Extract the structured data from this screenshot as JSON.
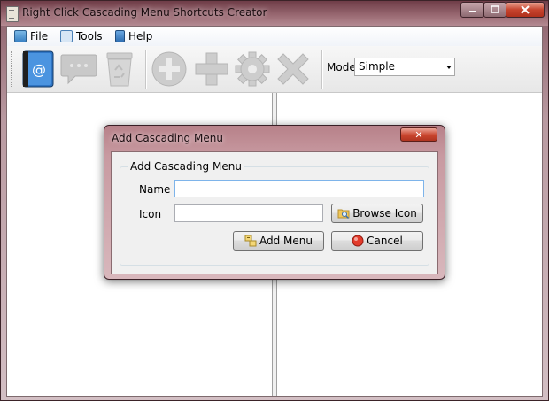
{
  "window": {
    "title": "Right Click Cascading Menu Shortcuts Creator"
  },
  "menubar": {
    "file": "File",
    "tools": "Tools",
    "help": "Help"
  },
  "toolbar": {
    "mode_label": "Mode",
    "mode_value": "Simple"
  },
  "dialog": {
    "title": "Add Cascading Menu",
    "close_glyph": "✕",
    "group_title": "Add Cascading Menu",
    "name_label": "Name",
    "name_value": "",
    "icon_label": "Icon",
    "icon_value": "",
    "browse_button": "Browse Icon",
    "add_button": "Add Menu",
    "cancel_button": "Cancel"
  }
}
